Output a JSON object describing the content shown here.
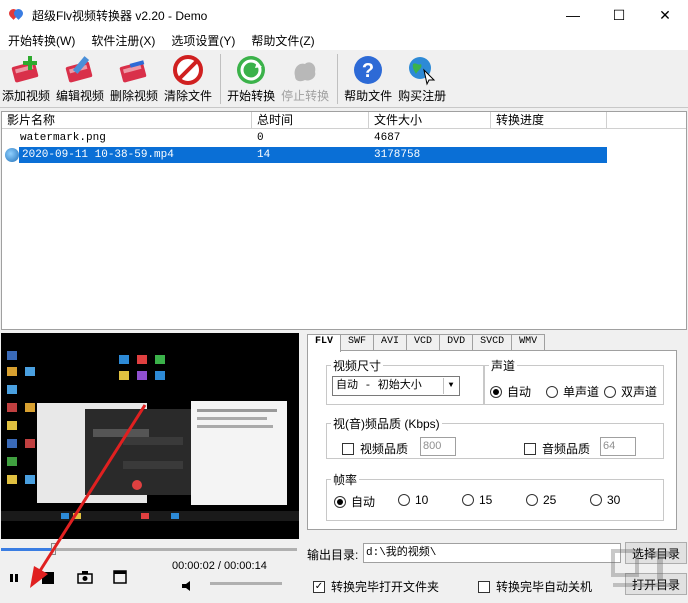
{
  "window": {
    "title": "超级Flv视频转换器 v2.20 - Demo",
    "minimize": "—",
    "maximize": "☐",
    "close": "✕"
  },
  "menu": [
    "开始转换(W)",
    "软件注册(X)",
    "选项设置(Y)",
    "帮助文件(Z)"
  ],
  "toolbar": {
    "add": "添加视频",
    "edit": "编辑视频",
    "delete": "删除视频",
    "clear": "清除文件",
    "start": "开始转换",
    "stop": "停止转换",
    "help": "帮助文件",
    "buy": "购买注册"
  },
  "filelist": {
    "columns": [
      "影片名称",
      "总时间",
      "文件大小",
      "转换进度"
    ],
    "rows": [
      {
        "name": "watermark.png",
        "time": "0",
        "size": "4687",
        "progress": "",
        "selected": false
      },
      {
        "name": "2020-09-11 10-38-59.mp4",
        "time": "14",
        "size": "3178758",
        "progress": "",
        "selected": true
      }
    ]
  },
  "player": {
    "time": "00:00:02 / 00:00:14",
    "seek_fraction": 0.17
  },
  "tabs": [
    "FLV",
    "SWF",
    "AVI",
    "VCD",
    "DVD",
    "SVCD",
    "WMV"
  ],
  "settings": {
    "video_size_label": "视频尺寸",
    "video_size_value": "自动 - 初始大小",
    "channel_label": "声道",
    "channel_options": [
      "自动",
      "单声道",
      "双声道"
    ],
    "quality_label": "视(音)频品质 (Kbps)",
    "video_quality_label": "视频品质",
    "video_quality_value": "800",
    "audio_quality_label": "音频品质",
    "audio_quality_value": "64",
    "fps_label": "帧率",
    "fps_options": [
      "自动",
      "10",
      "15",
      "25",
      "30"
    ]
  },
  "output": {
    "label": "输出目录:",
    "path": "d:\\我的视频\\",
    "choose_btn": "选择目录",
    "open_btn": "打开目录",
    "open_after": "转换完毕打开文件夹",
    "shutdown_after": "转换完毕自动关机"
  },
  "colors": {
    "selection": "#0a6fd6",
    "annotation_arrow": "#e02020"
  }
}
